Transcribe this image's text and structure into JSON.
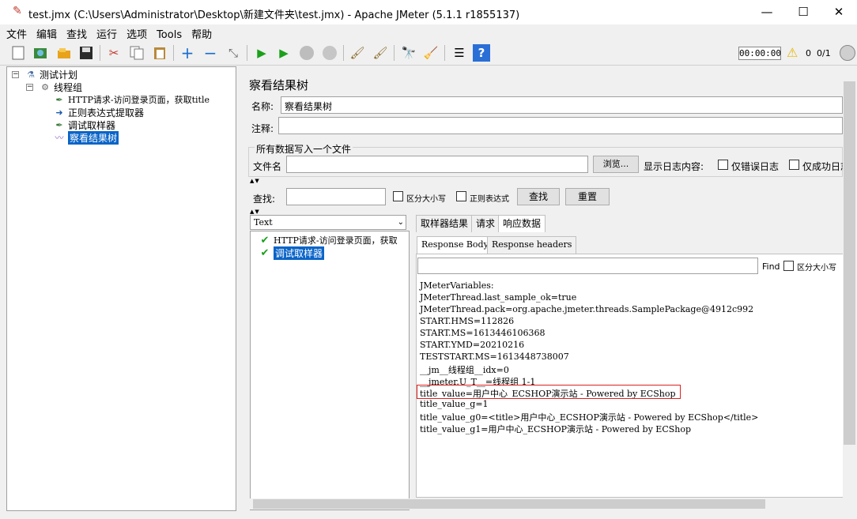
{
  "window": {
    "title": "test.jmx (C:\\Users\\Administrator\\Desktop\\新建文件夹\\test.jmx) - Apache JMeter (5.1.1 r1855137)",
    "minimize": "—",
    "maximize": "☐",
    "close": "✕"
  },
  "menu": [
    "文件",
    "编辑",
    "查找",
    "运行",
    "选项",
    "Tools",
    "帮助"
  ],
  "toolbar": {
    "timer": "00:00:00",
    "error_count": "0",
    "thread_ratio": "0/1"
  },
  "tree": {
    "items": [
      {
        "label": "测试计划",
        "icon": "test-plan-icon"
      },
      {
        "label": "线程组",
        "icon": "thread-group-icon"
      },
      {
        "label": "HTTP请求-访问登录页面，获取title",
        "icon": "http-request-icon"
      },
      {
        "label": "正则表达式提取器",
        "icon": "regex-extractor-icon"
      },
      {
        "label": "调试取样器",
        "icon": "debug-sampler-icon"
      },
      {
        "label": "察看结果树",
        "icon": "results-tree-icon",
        "selected": true
      }
    ]
  },
  "panel": {
    "title": "察看结果树",
    "name_label": "名称:",
    "name_value": "察看结果树",
    "comment_label": "注释:",
    "comment_value": "",
    "file_group_title": "所有数据写入一个文件",
    "filename_label": "文件名",
    "browse_button": "浏览...",
    "log_label": "显示日志内容:",
    "errors_only": "仅错误日志",
    "success_only": "仅成功日志",
    "search_label": "查找:",
    "case_sensitive": "区分大小写",
    "regex": "正则表达式",
    "search_button": "查找",
    "reset_button": "重置"
  },
  "results": {
    "renderer": "Text",
    "samples": [
      {
        "label": "HTTP请求-访问登录页面，获取",
        "status": "success"
      },
      {
        "label": "调试取样器",
        "status": "success",
        "selected": true
      }
    ],
    "tabs": [
      "取样器结果",
      "请求",
      "响应数据"
    ],
    "active_tab": "响应数据",
    "sub_tabs": [
      "Response Body",
      "Response headers"
    ],
    "find_label": "Find",
    "find_case": "区分大小写",
    "body_lines": [
      "JMeterVariables:",
      "JMeterThread.last_sample_ok=true",
      "JMeterThread.pack=org.apache.jmeter.threads.SamplePackage@4912c992",
      "START.HMS=112826",
      "START.MS=1613446106368",
      "START.YMD=20210216",
      "TESTSTART.MS=1613448738007",
      "__jm__线程组__idx=0",
      "__jmeter.U_T__=线程组 1-1",
      "title_value=用户中心_ECSHOP演示站 - Powered by ECShop",
      "title_value_g=1",
      "title_value_g0=<title>用户中心_ECSHOP演示站 - Powered by ECShop</title>",
      "title_value_g1=用户中心_ECSHOP演示站 - Powered by ECShop"
    ]
  }
}
